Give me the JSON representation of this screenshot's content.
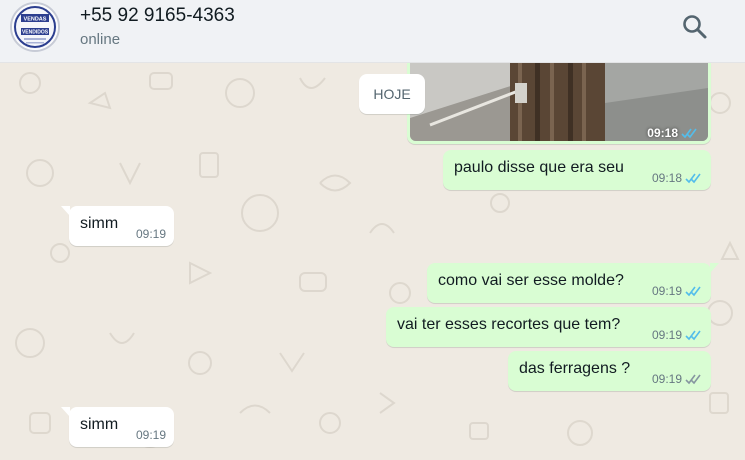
{
  "header": {
    "contact_name": "+55 92 9165-4363",
    "status": "online",
    "avatar_text_top": "VENDAS",
    "avatar_text_bottom": "VENDIDOS"
  },
  "chat": {
    "date_chip": "HOJE",
    "messages": [
      {
        "dir": "out",
        "type": "image",
        "time": "09:18",
        "status": "read"
      },
      {
        "dir": "out",
        "text": "paulo disse que era seu",
        "time": "09:18",
        "status": "read"
      },
      {
        "dir": "in",
        "text": "simm",
        "time": "09:19"
      },
      {
        "dir": "out",
        "text": "como vai ser esse molde?",
        "time": "09:19",
        "status": "read"
      },
      {
        "dir": "out",
        "text": "vai ter esses recortes que tem?",
        "time": "09:19",
        "status": "read"
      },
      {
        "dir": "out",
        "text": "das ferragens ?",
        "time": "09:19",
        "status": "delivered"
      },
      {
        "dir": "in",
        "text": "simm",
        "time": "09:19"
      }
    ]
  },
  "colors": {
    "outgoing_bubble": "#d9fdd3",
    "incoming_bubble": "#ffffff",
    "chat_background": "#efeae2",
    "read_ticks": "#53bdeb",
    "delivered_ticks": "#8696a0"
  },
  "icons": {
    "search": "search-icon",
    "read": "double-check-icon",
    "delivered": "double-check-icon"
  }
}
